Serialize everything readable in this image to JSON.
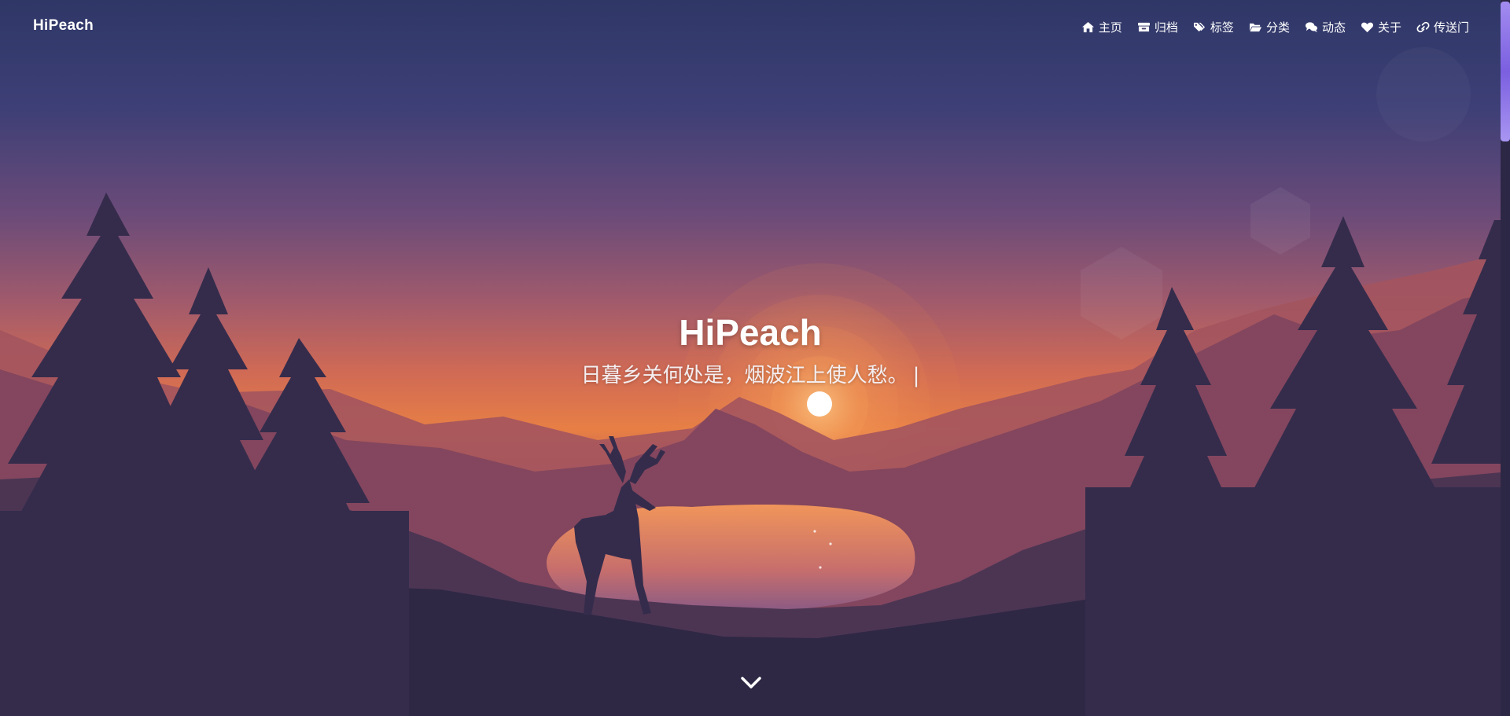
{
  "site": {
    "brand": "HiPeach"
  },
  "nav": {
    "items": [
      {
        "label": "主页",
        "icon": "home-icon"
      },
      {
        "label": "归档",
        "icon": "archive-icon"
      },
      {
        "label": "标签",
        "icon": "tags-icon"
      },
      {
        "label": "分类",
        "icon": "folder-open-icon"
      },
      {
        "label": "动态",
        "icon": "comments-icon"
      },
      {
        "label": "关于",
        "icon": "heart-icon"
      },
      {
        "label": "传送门",
        "icon": "link-icon"
      }
    ]
  },
  "hero": {
    "title": "HiPeach",
    "subtitle": "日暮乡关何处是，烟波江上使人愁。",
    "cursor": "|"
  },
  "icons": {
    "scroll_down": "chevron-down-icon"
  },
  "colors": {
    "sky_top": "#2f3767",
    "sky_mid": "#7e4f74",
    "horizon": "#f0854a",
    "sun": "#ffffff",
    "silhouette": "#2e2845",
    "scrollbar": "#8b6cea",
    "text": "#ffffff"
  }
}
